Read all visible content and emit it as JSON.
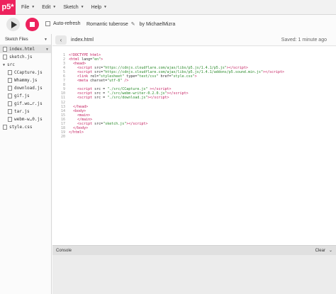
{
  "app": {
    "logo": "p5*"
  },
  "menu": [
    {
      "label": "File"
    },
    {
      "label": "Edit"
    },
    {
      "label": "Sketch"
    },
    {
      "label": "Help"
    }
  ],
  "toolbar": {
    "autorefresh_label": "Auto-refresh",
    "sketch_name": "Romantic tuberose",
    "by_user": "by MichaelMizra"
  },
  "sidebar": {
    "title": "Sketch Files",
    "files": [
      {
        "name": "index.html",
        "selected": true
      },
      {
        "name": "sketch.js"
      },
      {
        "name": "src",
        "folder": true
      },
      {
        "name": "CCapture.js",
        "indent": true
      },
      {
        "name": "Whammy.js",
        "indent": true
      },
      {
        "name": "download.js",
        "indent": true
      },
      {
        "name": "gif.js",
        "indent": true
      },
      {
        "name": "gif.wo…r.js",
        "indent": true
      },
      {
        "name": "tar.js",
        "indent": true
      },
      {
        "name": "webm-w…0.js",
        "indent": true
      },
      {
        "name": "style.css"
      }
    ]
  },
  "editor": {
    "tab": "index.html",
    "saved": "Saved: 1 minute ago",
    "line_numbers": [
      "1",
      "2",
      "3",
      "4",
      "5",
      "6",
      "7",
      "8",
      "9",
      "10",
      "11",
      "12",
      "13",
      "14",
      "15",
      "16",
      "17",
      "18",
      "19",
      "20"
    ]
  },
  "console": {
    "title": "Console",
    "clear_label": "Clear"
  }
}
